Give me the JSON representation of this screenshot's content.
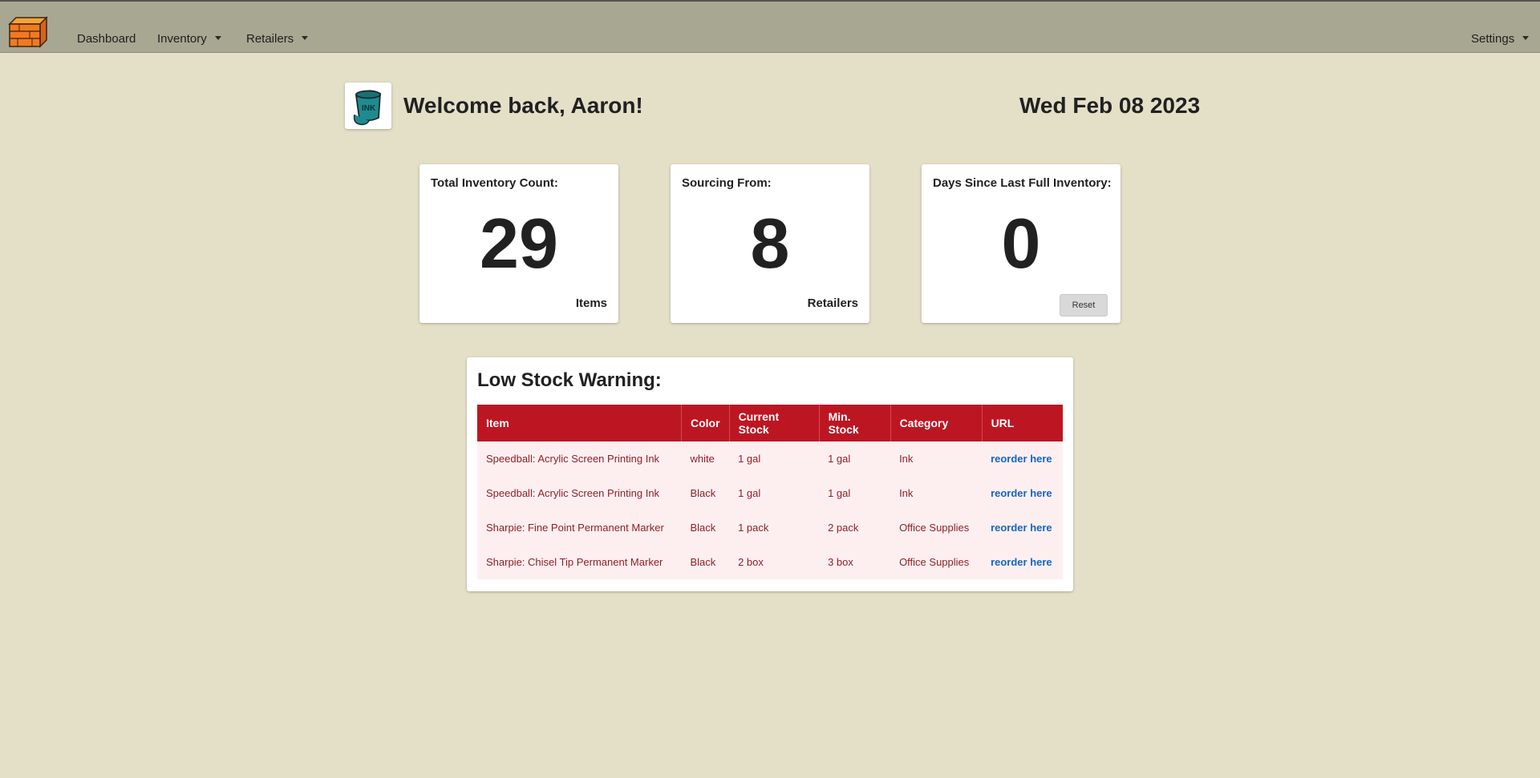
{
  "nav": {
    "items": [
      {
        "label": "Dashboard"
      },
      {
        "label": "Inventory"
      },
      {
        "label": "Retailers"
      }
    ],
    "settings_label": "Settings"
  },
  "header": {
    "welcome": "Welcome back, Aaron!",
    "date": "Wed Feb 08 2023"
  },
  "cards": [
    {
      "title": "Total Inventory Count:",
      "value": "29",
      "unit": "Items"
    },
    {
      "title": "Sourcing From:",
      "value": "8",
      "unit": "Retailers"
    },
    {
      "title": "Days Since Last Full Inventory:",
      "value": "0",
      "button": "Reset"
    }
  ],
  "low_stock": {
    "title": "Low Stock Warning:",
    "columns": [
      "Item",
      "Color",
      "Current Stock",
      "Min. Stock",
      "Category",
      "URL"
    ],
    "rows": [
      [
        "Speedball: Acrylic Screen Printing Ink",
        "white",
        "1 gal",
        "1 gal",
        "Ink",
        "reorder here"
      ],
      [
        "Speedball: Acrylic Screen Printing Ink",
        "Black",
        "1 gal",
        "1 gal",
        "Ink",
        "reorder here"
      ],
      [
        "Sharpie: Fine Point Permanent Marker",
        "Black",
        "1 pack",
        "2 pack",
        "Office Supplies",
        "reorder here"
      ],
      [
        "Sharpie: Chisel Tip Permanent Marker",
        "Black",
        "2 box",
        "3 box",
        "Office Supplies",
        "reorder here"
      ]
    ]
  },
  "icons": {
    "brand": "inventory-crate-icon",
    "header": "ink-bucket-icon"
  },
  "colors": {
    "navbar": "#a8a792",
    "background": "#e4dfc7",
    "table_header": "#bd1623",
    "row_text": "#8e2027",
    "row_bg": "#fdeff0",
    "link": "#1565c0"
  }
}
